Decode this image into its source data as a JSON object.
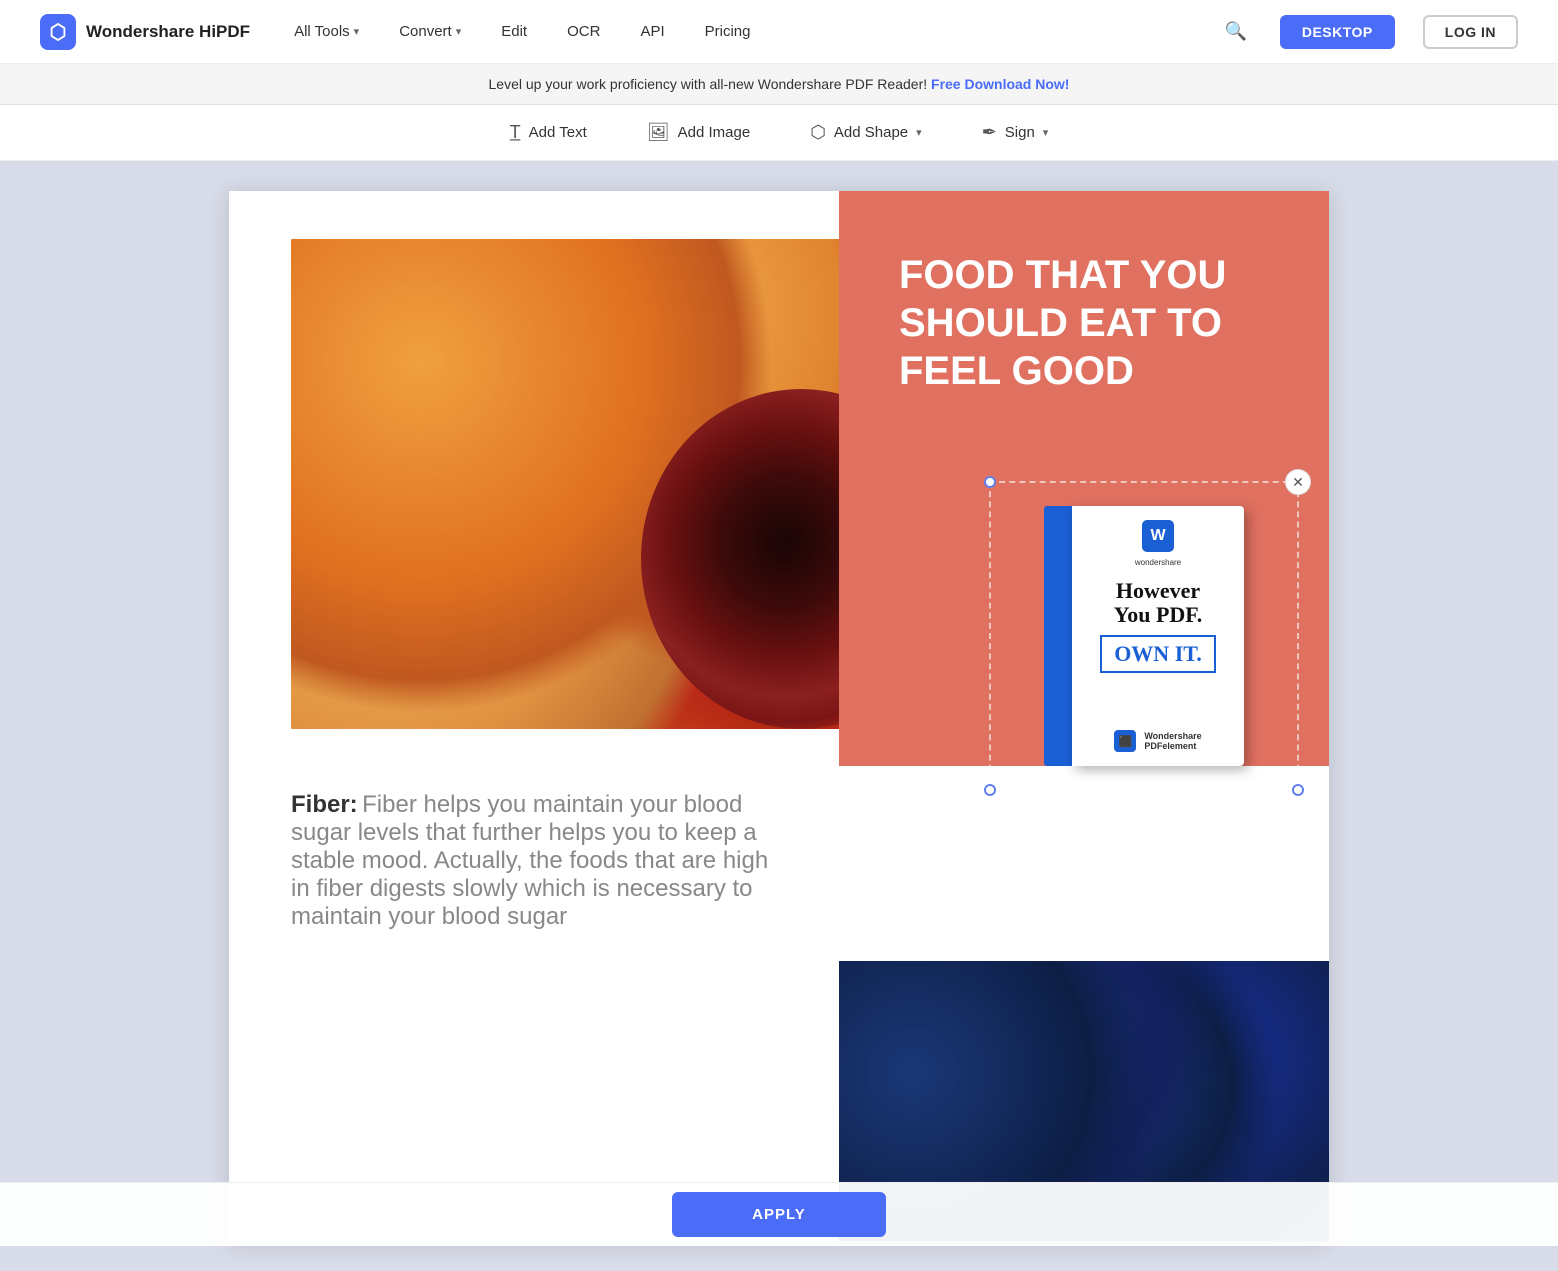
{
  "nav": {
    "logo_text": "Wondershare HiPDF",
    "items": [
      {
        "label": "All Tools",
        "has_dropdown": true
      },
      {
        "label": "Convert",
        "has_dropdown": true
      },
      {
        "label": "Edit",
        "has_dropdown": false
      },
      {
        "label": "OCR",
        "has_dropdown": false
      },
      {
        "label": "API",
        "has_dropdown": false
      },
      {
        "label": "Pricing",
        "has_dropdown": false
      }
    ],
    "desktop_btn": "DESKTOP",
    "login_btn": "LOG IN"
  },
  "banner": {
    "text": "Level up your work proficiency with all-new Wondershare PDF Reader!",
    "link": "Free Download Now!"
  },
  "toolbar": {
    "add_text": "Add Text",
    "add_image": "Add Image",
    "add_shape": "Add Shape",
    "sign": "Sign"
  },
  "content": {
    "sidebar_title": "FOOD THAT YOU SHOULD EAT TO FEEL GOOD",
    "product_book": {
      "brand": "wondershare",
      "title_line1": "However",
      "title_line2": "You PDF.",
      "own_label": "OWN IT.",
      "footer_text1": "Wondershare",
      "footer_text2": "PDFelement"
    },
    "fiber_bold": "Fiber:",
    "fiber_text": " Fiber helps you maintain your blood sugar levels that further helps you to keep a stable mood. Actually, the foods that are high in fiber digests slowly which is necessary to maintain your blood sugar"
  },
  "apply_btn": "APPLY"
}
